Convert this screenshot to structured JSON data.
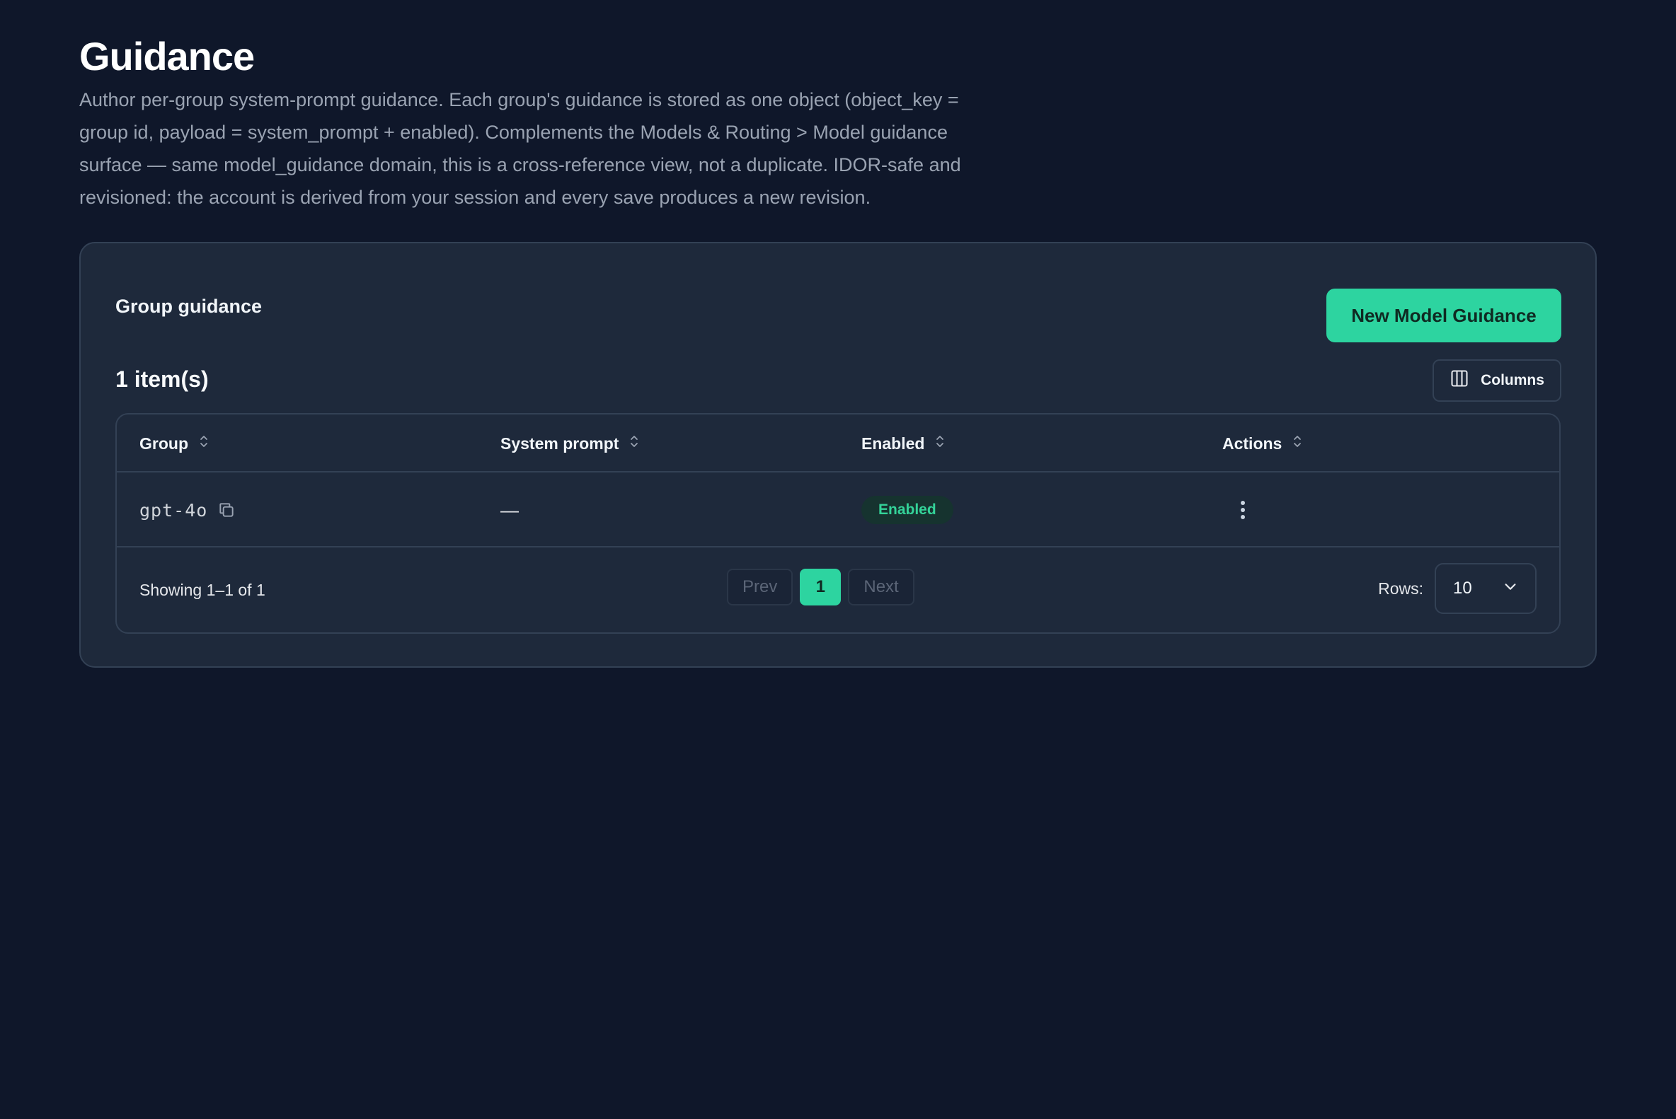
{
  "header": {
    "title": "Guidance",
    "description": "Author per-group system-prompt guidance. Each group's guidance is stored as one object (object_key = group id, payload = system_prompt + enabled). Complements the Models & Routing > Model guidance surface — same model_guidance domain, this is a cross-reference view, not a duplicate. IDOR-safe and revisioned: the account is derived from your session and every save produces a new revision."
  },
  "card": {
    "title": "Group guidance",
    "new_button_label": "New Model Guidance",
    "item_count": "1 item(s)",
    "columns_button_label": "Columns"
  },
  "table": {
    "columns": [
      "Group",
      "System prompt",
      "Enabled",
      "Actions"
    ],
    "rows": [
      {
        "group": "gpt-4o",
        "system_prompt": "—",
        "enabled": "Enabled"
      }
    ]
  },
  "footer": {
    "showing": "Showing 1–1 of 1",
    "prev_label": "Prev",
    "current_page": "1",
    "next_label": "Next",
    "rows_label": "Rows:",
    "rows_value": "10"
  },
  "colors": {
    "background": "#0f172a",
    "card": "#1e293b",
    "accent": "#2dd4a0",
    "badge_text": "#34d399"
  },
  "icons": {
    "sort": "sort-icon",
    "copy": "copy-icon",
    "columns": "columns-icon",
    "kebab": "kebab-menu-icon",
    "chevron": "chevron-down-icon"
  }
}
